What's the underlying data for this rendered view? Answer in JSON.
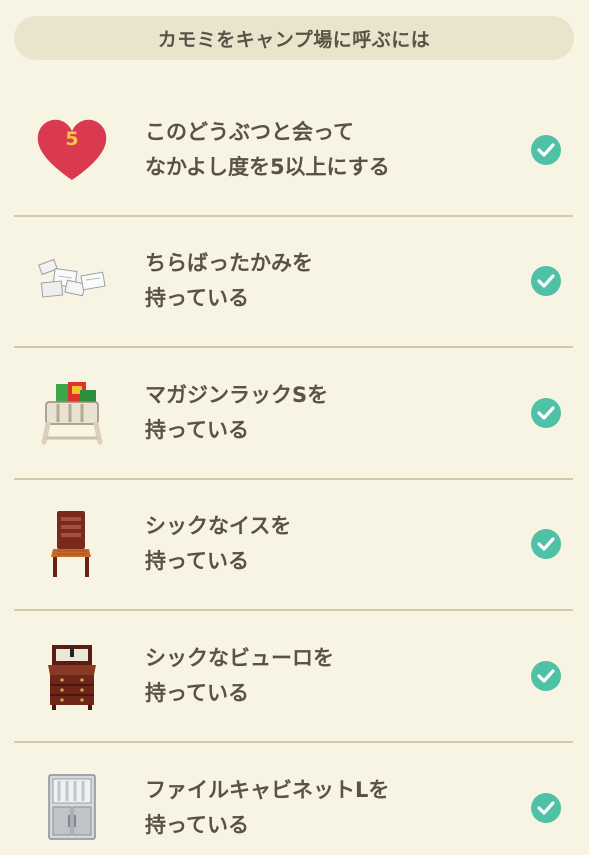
{
  "header": {
    "title": "カモミをキャンプ場に呼ぶには"
  },
  "requirements": [
    {
      "line1": "このどうぶつと会って",
      "line2": "なかよし度を5以上にする",
      "icon": "heart-icon",
      "heart_value": "5",
      "completed": true
    },
    {
      "line1": "ちらばったかみを",
      "line2": "持っている",
      "icon": "scattered-paper-icon",
      "completed": true
    },
    {
      "line1": "マガジンラックSを",
      "line2": "持っている",
      "icon": "magazine-rack-icon",
      "completed": true
    },
    {
      "line1": "シックなイスを",
      "line2": "持っている",
      "icon": "chic-chair-icon",
      "completed": true
    },
    {
      "line1": "シックなビューロを",
      "line2": "持っている",
      "icon": "chic-bureau-icon",
      "completed": true
    },
    {
      "line1": "ファイルキャビネットLを",
      "line2": "持っている",
      "icon": "file-cabinet-icon",
      "completed": true
    }
  ],
  "colors": {
    "background": "#f8f4e3",
    "header_bg": "#ebe4cc",
    "check": "#4fc1a7",
    "heart": "#d93a4f",
    "text": "#5a5247"
  }
}
